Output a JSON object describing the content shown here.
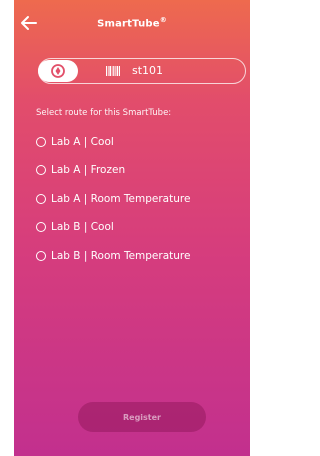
{
  "header": {
    "title": "SmartTube",
    "title_mark": "®"
  },
  "scan": {
    "value": "st101"
  },
  "routes": {
    "prompt": "Select route for this SmartTube:",
    "items": [
      {
        "label": "Lab A | Cool",
        "selected": false
      },
      {
        "label": "Lab A | Frozen",
        "selected": false
      },
      {
        "label": "Lab A | Room Temperature",
        "selected": false
      },
      {
        "label": "Lab B | Cool",
        "selected": false
      },
      {
        "label": "Lab B | Room Temperature",
        "selected": false
      }
    ]
  },
  "footer": {
    "register_label": "Register"
  },
  "colors": {
    "gradient_top": "#ee6a4e",
    "gradient_bottom": "#c2308e",
    "scan_icon": "#e2506a"
  },
  "icons": {
    "back": "back-arrow-icon",
    "scan": "scan-icon",
    "barcode": "barcode-icon",
    "radio": "radio-icon"
  }
}
